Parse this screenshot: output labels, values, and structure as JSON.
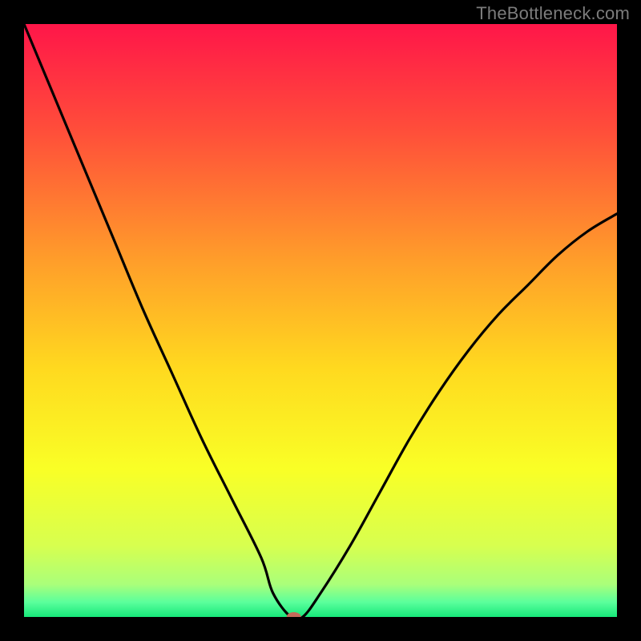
{
  "watermark": "TheBottleneck.com",
  "chart_data": {
    "type": "line",
    "title": "",
    "xlabel": "",
    "ylabel": "",
    "xlim": [
      0,
      100
    ],
    "ylim": [
      0,
      100
    ],
    "grid": false,
    "legend": false,
    "background": "rainbow-gradient-red-to-green",
    "curve_description": "V-shaped bottleneck curve with minimum near x=45, left arm rising to y=100 at x=0, right arm rising to y~=68 at x=100",
    "series": [
      {
        "name": "bottleneck-curve",
        "x": [
          0,
          5,
          10,
          15,
          20,
          25,
          30,
          35,
          40,
          42,
          45,
          47,
          50,
          55,
          60,
          65,
          70,
          75,
          80,
          85,
          90,
          95,
          100
        ],
        "y": [
          100,
          88,
          76,
          64,
          52,
          41,
          30,
          20,
          10,
          4,
          0,
          0,
          4,
          12,
          21,
          30,
          38,
          45,
          51,
          56,
          61,
          65,
          68
        ]
      }
    ],
    "marker": {
      "x": 45.5,
      "y": 0,
      "color": "#c46a5a",
      "rx": 9,
      "ry": 6
    },
    "gradient_stops": [
      {
        "offset": 0,
        "color": "#ff1649"
      },
      {
        "offset": 0.18,
        "color": "#ff4e3a"
      },
      {
        "offset": 0.4,
        "color": "#ff9e2a"
      },
      {
        "offset": 0.58,
        "color": "#ffd91f"
      },
      {
        "offset": 0.75,
        "color": "#f9ff26"
      },
      {
        "offset": 0.88,
        "color": "#d7ff4f"
      },
      {
        "offset": 0.945,
        "color": "#aaff7a"
      },
      {
        "offset": 0.975,
        "color": "#5bff9c"
      },
      {
        "offset": 1.0,
        "color": "#17e87a"
      }
    ]
  }
}
